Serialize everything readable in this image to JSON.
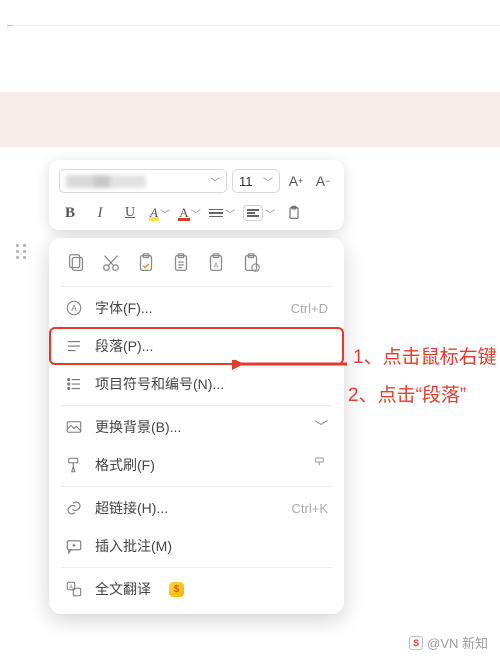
{
  "toolbar": {
    "font_size": "11",
    "increase_label": "A",
    "increase_sup": "+",
    "decrease_label": "A",
    "decrease_sup": "−",
    "bold": "B",
    "italic": "I",
    "underline": "U",
    "highlight": "A",
    "font_color": "A"
  },
  "menu": {
    "font": {
      "label": "字体(F)...",
      "shortcut": "Ctrl+D"
    },
    "paragraph": {
      "label": "段落(P)..."
    },
    "bullets": {
      "label": "项目符号和编号(N)..."
    },
    "background": {
      "label": "更换背景(B)..."
    },
    "format_painter": {
      "label": "格式刷(F)"
    },
    "hyperlink": {
      "label": "超链接(H)...",
      "shortcut": "Ctrl+K"
    },
    "comment": {
      "label": "插入批注(M)"
    },
    "translate": {
      "label": "全文翻译",
      "badge": "$"
    }
  },
  "annotations": {
    "step1": "1、点击鼠标右键",
    "step2": "2、点击“段落”"
  },
  "watermark": "@VN 新知"
}
